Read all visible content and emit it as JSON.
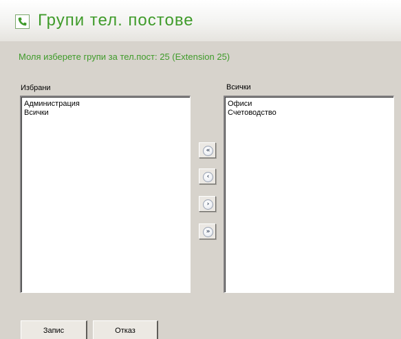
{
  "header": {
    "title": "Групи тел. постове",
    "icon": "phone-icon",
    "accent_color": "#3f9b2a"
  },
  "instruction": "Моля изберете групи за тел.пост: 25 (Extension 25)",
  "selected": {
    "label": "Избрани",
    "items": [
      "Администрация",
      "Всички"
    ]
  },
  "available": {
    "label": "Всички",
    "items": [
      "Офиси",
      "Счетоводство"
    ]
  },
  "move_buttons": {
    "all_left": "«",
    "one_left": "‹",
    "one_right": "›",
    "all_right": "»"
  },
  "actions": {
    "save": "Запис",
    "cancel": "Отказ"
  }
}
